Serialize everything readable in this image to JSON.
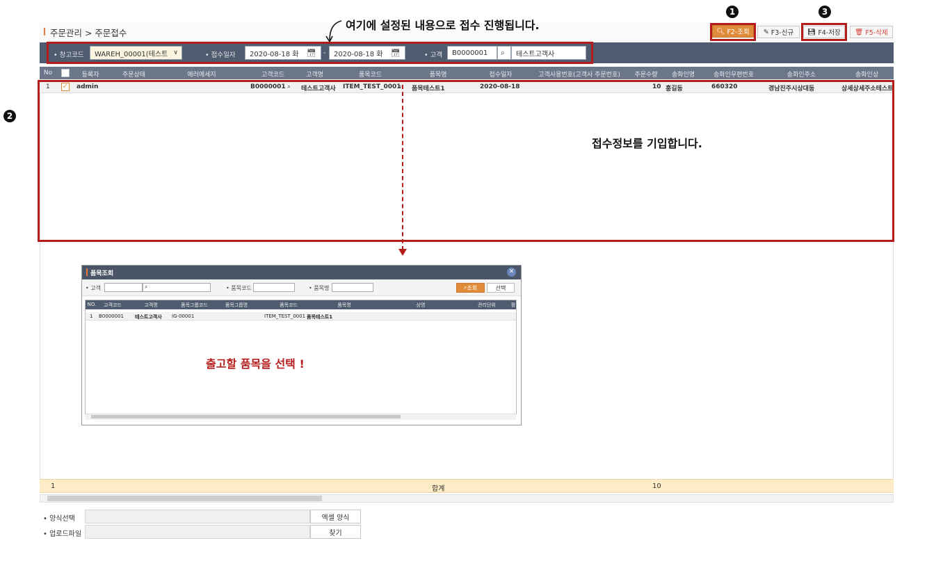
{
  "breadcrumb": "주문관리 > 주문접수",
  "toolbar": {
    "search": "F2-조회",
    "new": "F3-신규",
    "save": "F4-저장",
    "delete": "F5-삭제"
  },
  "callouts": {
    "n1": "1",
    "n2": "2",
    "n3": "3",
    "top_note": "여기에 설정된 내용으로 접수 진행됩니다.",
    "mid_note": "접수정보를 기입합니다.",
    "popup_note": "출고할 품목을 선택 !"
  },
  "search": {
    "warehouse_label": "• 창고코드",
    "warehouse_value": "WAREH_00001(테스트",
    "date_label": "• 접수일자",
    "date_from": "2020-08-18 화",
    "date_sep": "-",
    "date_to": "2020-08-18 화",
    "customer_label": "• 고객",
    "customer_code": "B0000001",
    "customer_name": "테스트고객사"
  },
  "grid": {
    "headers": [
      "No",
      "",
      "등록자",
      "주문상태",
      "에러메세지",
      "고객코드",
      "고객명",
      "품목코드",
      "품목명",
      "접수일자",
      "고객사용번호(고객사 주문번호)",
      "주문수량",
      "송화인명",
      "송화인우편번호",
      "송화인주소",
      "송화인상"
    ],
    "row": {
      "no": "1",
      "registrant": "admin",
      "customer_code": "B0000001",
      "customer_name": "테스트고객사",
      "item_code": "ITEM_TEST_0001",
      "item_name": "품목테스트1",
      "date": "2020-08-18",
      "qty": "10",
      "sender_name": "홍길동",
      "sender_zip": "660320",
      "sender_addr": "경남진주시상대동",
      "sender_detail": "상세상세주소테스트"
    }
  },
  "popup": {
    "title": "품목조회",
    "f_customer": "• 고객",
    "f_item_code": "• 품목코드",
    "f_item_name": "• 품목명",
    "btn_search": "조회",
    "btn_select": "선택",
    "headers": [
      "NO.",
      "고객코드",
      "고객명",
      "품목그룹코드",
      "품목그룹명",
      "품목코드",
      "품목명",
      "상명",
      "관리단위",
      "활"
    ],
    "row": {
      "no": "1",
      "customer_code": "B0000001",
      "customer_name": "테스트고객사",
      "group_code": "IG-00001",
      "item_code": "ITEM_TEST_0001",
      "item_name": "품목테스트1"
    }
  },
  "footer": {
    "count": "1",
    "total_label": "합계",
    "total_qty": "10"
  },
  "bottom": {
    "form_label": "• 양식선택",
    "excel_btn": "엑셀 양식",
    "upload_label": "• 업로드파일",
    "find_btn": "찾기"
  },
  "icons": {
    "search": "search-icon",
    "calendar": "calendar-icon",
    "check": "check-icon",
    "edit": "edit-icon",
    "save": "save-icon",
    "trash": "trash-icon",
    "close": "close-icon"
  },
  "colors": {
    "accent": "#e08b3a",
    "annotation": "#b51d1d",
    "bar": "#4f5b6e"
  }
}
